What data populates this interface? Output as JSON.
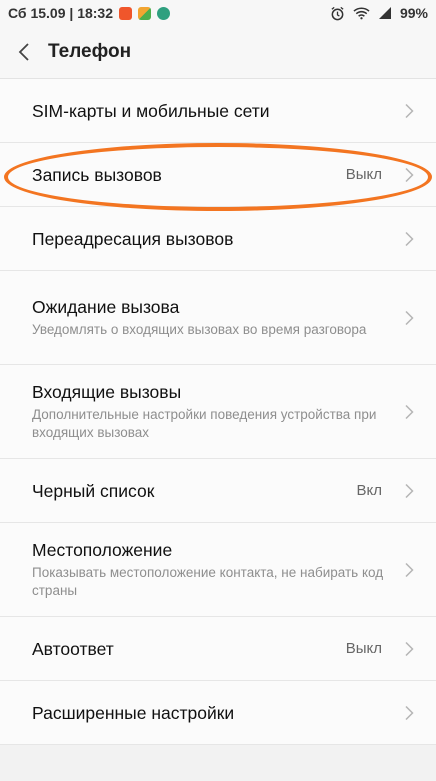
{
  "status": {
    "datetime": "Сб 15.09 | 18:32",
    "battery": "99%"
  },
  "header": {
    "title": "Телефон"
  },
  "items": [
    {
      "title": "SIM-карты и мобильные сети",
      "subtitle": "",
      "value": ""
    },
    {
      "title": "Запись вызовов",
      "subtitle": "",
      "value": "Выкл"
    },
    {
      "title": "Переадресация вызовов",
      "subtitle": "",
      "value": ""
    },
    {
      "title": "Ожидание вызова",
      "subtitle": "Уведомлять о входящих вызовах во время разговора",
      "value": ""
    },
    {
      "title": "Входящие вызовы",
      "subtitle": "Дополнительные настройки поведения устройства при входящих вызовах",
      "value": ""
    },
    {
      "title": "Черный список",
      "subtitle": "",
      "value": "Вкл"
    },
    {
      "title": "Местоположение",
      "subtitle": "Показывать местоположение контакта, не набирать код страны",
      "value": ""
    },
    {
      "title": "Автоответ",
      "subtitle": "",
      "value": "Выкл"
    },
    {
      "title": "Расширенные настройки",
      "subtitle": "",
      "value": ""
    }
  ],
  "colors": {
    "highlight": "#f37521"
  }
}
